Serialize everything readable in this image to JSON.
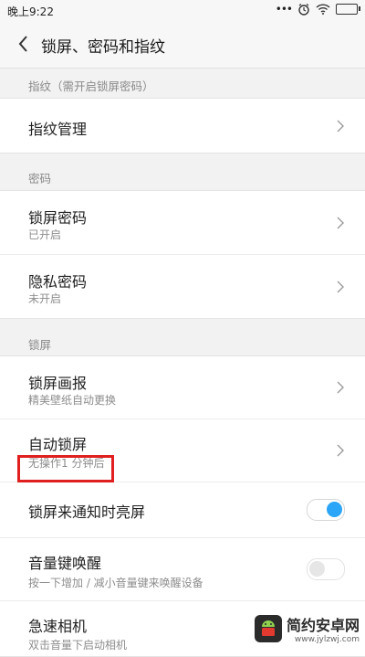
{
  "status": {
    "time": "晚上9:22",
    "dots": "•••"
  },
  "appbar": {
    "title": "锁屏、密码和指纹"
  },
  "sections": {
    "fingerprint_header": "指纹（需开启锁屏密码）",
    "fingerprint_manage": "指纹管理",
    "password_header": "密码",
    "lock_password_label": "锁屏密码",
    "lock_password_sub": "已开启",
    "privacy_password_label": "隐私密码",
    "privacy_password_sub": "未开启",
    "lockscreen_header": "锁屏",
    "lock_pictorial_label": "锁屏画报",
    "lock_pictorial_sub": "精美壁纸自动更换",
    "auto_lock_label": "自动锁屏",
    "auto_lock_sub": "无操作1 分钟后",
    "wake_on_notify_label": "锁屏来通知时亮屏",
    "wake_on_notify_on": true,
    "volume_wake_label": "音量键唤醒",
    "volume_wake_sub": "按一下增加 / 减小音量键来唤醒设备",
    "volume_wake_on": false,
    "quick_camera_label": "急速相机",
    "quick_camera_sub": "双击音量下启动相机"
  },
  "watermark": {
    "name": "简约安卓网",
    "url": "www.jylzwj.com"
  },
  "colors": {
    "accent": "#2ba5f7",
    "highlight": "#e0201f"
  }
}
